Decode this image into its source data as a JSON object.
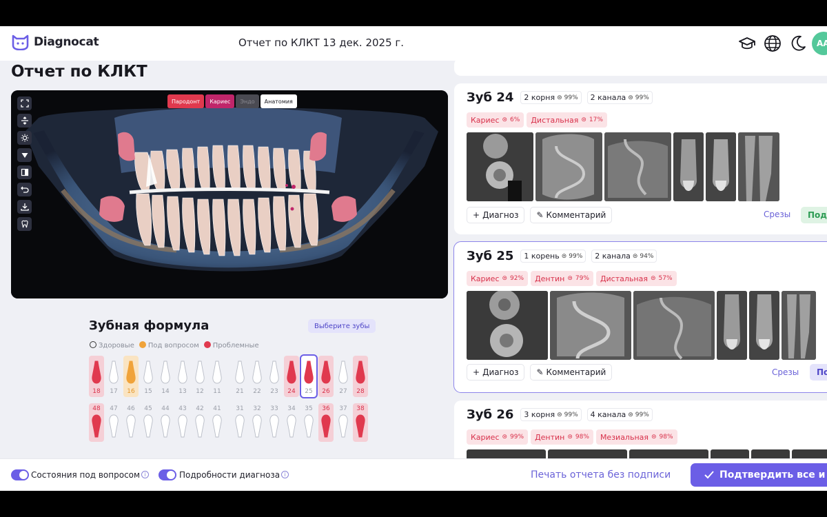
{
  "header": {
    "brand": "Diagnocat",
    "report_title": "Отчет по КЛКТ 13 дек. 2025 г.",
    "avatar_initials": "АА"
  },
  "page_title": "Отчет по КЛКТ",
  "viewer": {
    "layer_tabs": [
      {
        "label": "Пародонт",
        "color": "#e0394e"
      },
      {
        "label": "Кариес",
        "color": "#c0266a"
      },
      {
        "label": "Эндо",
        "color": "#4a4a52"
      },
      {
        "label": "Анатомия",
        "color": "#ffffff"
      }
    ],
    "tools": [
      "expand-icon",
      "vertical-resize-icon",
      "brightness-icon",
      "triangle-down-icon",
      "invert-icon",
      "undo-icon",
      "download-icon",
      "tooth-icon"
    ]
  },
  "formula": {
    "title": "Зубная формула",
    "select_button": "Выберите зубы",
    "legend": [
      {
        "label": "Здоровые",
        "color": "#ffffff"
      },
      {
        "label": "Под вопросом",
        "color": "#f0a33a"
      },
      {
        "label": "Проблемные",
        "color": "#e0394e"
      }
    ],
    "upper": [
      {
        "n": "18",
        "s": "bad"
      },
      {
        "n": "17",
        "s": "ok"
      },
      {
        "n": "16",
        "s": "q"
      },
      {
        "n": "15",
        "s": "ok"
      },
      {
        "n": "14",
        "s": "ok"
      },
      {
        "n": "13",
        "s": "ok"
      },
      {
        "n": "12",
        "s": "ok"
      },
      {
        "n": "11",
        "s": "ok"
      },
      {
        "n": "21",
        "s": "ok"
      },
      {
        "n": "22",
        "s": "ok"
      },
      {
        "n": "23",
        "s": "ok"
      },
      {
        "n": "24",
        "s": "bad"
      },
      {
        "n": "25",
        "s": "sel"
      },
      {
        "n": "26",
        "s": "bad"
      },
      {
        "n": "27",
        "s": "ok"
      },
      {
        "n": "28",
        "s": "bad"
      }
    ],
    "lower": [
      {
        "n": "48",
        "s": "bad"
      },
      {
        "n": "47",
        "s": "ok"
      },
      {
        "n": "46",
        "s": "ok"
      },
      {
        "n": "45",
        "s": "ok"
      },
      {
        "n": "44",
        "s": "ok"
      },
      {
        "n": "43",
        "s": "ok"
      },
      {
        "n": "42",
        "s": "ok"
      },
      {
        "n": "41",
        "s": "ok"
      },
      {
        "n": "31",
        "s": "ok"
      },
      {
        "n": "32",
        "s": "ok"
      },
      {
        "n": "33",
        "s": "ok"
      },
      {
        "n": "34",
        "s": "ok"
      },
      {
        "n": "35",
        "s": "ok"
      },
      {
        "n": "36",
        "s": "bad"
      },
      {
        "n": "37",
        "s": "ok"
      },
      {
        "n": "38",
        "s": "bad"
      }
    ]
  },
  "cards": [
    {
      "title": "Зуб 24",
      "roots": "2 корня",
      "roots_pct": "99%",
      "canals": "2 канала",
      "canals_pct": "99%",
      "findings": [
        {
          "label": "Кариес",
          "pct": "6%"
        },
        {
          "label": "Дистальная",
          "pct": "17%"
        }
      ],
      "diagnosis_label": "Диагноз",
      "comment_label": "Комментарий",
      "slices_label": "Срезы",
      "confirm_label": "Подт"
    },
    {
      "title": "Зуб 25",
      "roots": "1 корень",
      "roots_pct": "99%",
      "canals": "2 канала",
      "canals_pct": "94%",
      "findings": [
        {
          "label": "Кариес",
          "pct": "92%"
        },
        {
          "label": "Дентин",
          "pct": "79%"
        },
        {
          "label": "Дистальная",
          "pct": "57%"
        }
      ],
      "diagnosis_label": "Диагноз",
      "comment_label": "Комментарий",
      "slices_label": "Срезы",
      "confirm_label": "По"
    },
    {
      "title": "Зуб 26",
      "roots": "3 корня",
      "roots_pct": "99%",
      "canals": "4 канала",
      "canals_pct": "99%",
      "findings": [
        {
          "label": "Кариес",
          "pct": "99%"
        },
        {
          "label": "Дентин",
          "pct": "98%"
        },
        {
          "label": "Мезиальная",
          "pct": "98%"
        }
      ]
    }
  ],
  "footer": {
    "toggle1": "Состояния под вопросом",
    "toggle2": "Подробности диагноза",
    "print_link": "Печать отчета без подписи",
    "confirm_all": "Подтвердить все и п"
  }
}
